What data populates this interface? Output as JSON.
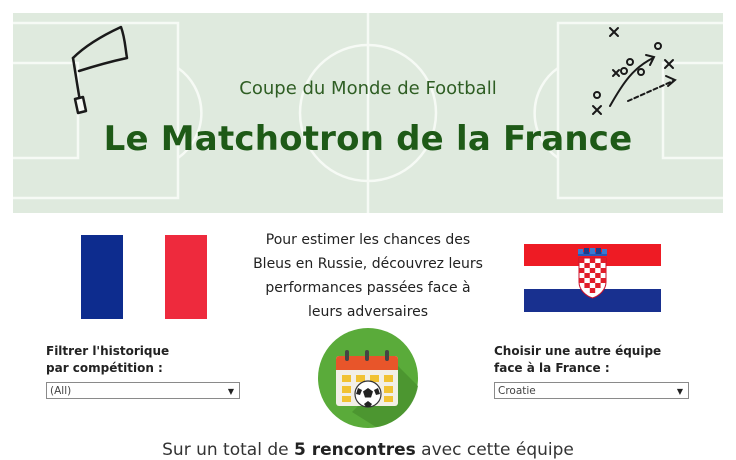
{
  "banner": {
    "subtitle": "Coupe du Monde de Football",
    "title": "Le Matchotron de la France"
  },
  "intro_text": "Pour estimer les chances des Bleus en Russie, découvrez leurs performances passées face à leurs adversaires",
  "filter_competition": {
    "label_line1": "Filtrer l'historique",
    "label_line2": "par compétition :",
    "value": "(All)"
  },
  "filter_team": {
    "label_line1": "Choisir une autre équipe",
    "label_line2": "face à la France :",
    "value": "Croatie"
  },
  "summary": {
    "prefix": "Sur un total de ",
    "count": "5 rencontres",
    "suffix": " avec cette équipe"
  },
  "icons": {
    "flag_left": "france-flag",
    "flag_right": "croatia-flag",
    "calendar": "calendar-football-icon",
    "banner_flag": "corner-flag-icon",
    "tactics": "tactics-board-icon"
  },
  "colors": {
    "title_green": "#1e5a17",
    "field_bg": "#dfeade",
    "france_blue": "#0d2c8e",
    "france_red": "#ee2a3d",
    "croatia_red": "#ee1b24",
    "croatia_blue": "#18308f",
    "calendar_circle": "#5aab3a"
  }
}
